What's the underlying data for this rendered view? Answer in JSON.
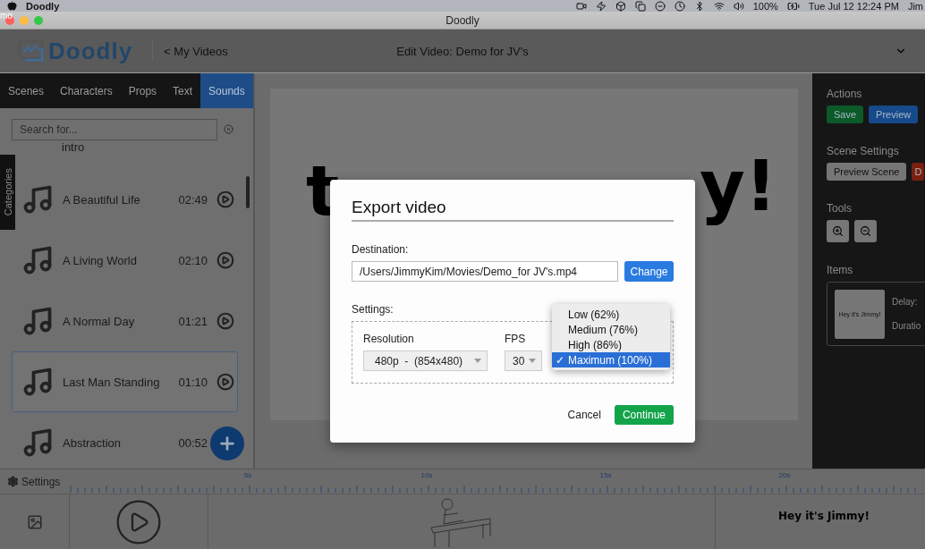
{
  "menubar": {
    "app": "Doodly",
    "battery": "100%",
    "clock": "Tue Jul 12  12:24 PM",
    "user": "Jim"
  },
  "edge_text": "mo",
  "window": {
    "title": "Doodly"
  },
  "header": {
    "logo": "Doodly",
    "back_link": "< My Videos",
    "title": "Edit Video: Demo for JV's"
  },
  "tabs": [
    {
      "label": "Scenes",
      "selected": false
    },
    {
      "label": "Characters",
      "selected": false
    },
    {
      "label": "Props",
      "selected": false
    },
    {
      "label": "Text",
      "selected": false
    },
    {
      "label": "Sounds",
      "selected": true
    }
  ],
  "search": {
    "placeholder": "Search for..."
  },
  "categories_tab": "Categories",
  "sounds": [
    {
      "name": "intro",
      "kind": "partial",
      "selected": false
    },
    {
      "name": "A Beautiful Life",
      "duration": "02:49",
      "selected": false
    },
    {
      "name": "A Living World",
      "duration": "02:10",
      "selected": false
    },
    {
      "name": "A Normal Day",
      "duration": "01:21",
      "selected": false
    },
    {
      "name": "Last Man Standing",
      "duration": "01:10",
      "selected": true
    },
    {
      "name": "Abstraction",
      "duration": "00:52",
      "kind": "covered",
      "selected": false
    }
  ],
  "canvas": {
    "fragments": [
      "t",
      "y!"
    ]
  },
  "actions": {
    "heading": "Actions",
    "buttons": [
      {
        "label": "Save",
        "kind": "save"
      },
      {
        "label": "Preview",
        "kind": "preview"
      }
    ]
  },
  "scene_settings": {
    "heading": "Scene Settings",
    "buttons": [
      {
        "label": "Preview Scene",
        "kind": "neutral"
      },
      {
        "label": "D",
        "kind": "danger"
      }
    ]
  },
  "tools": {
    "heading": "Tools"
  },
  "items": {
    "heading": "Items",
    "thumbnail_text": "Hey it's Jimmy!",
    "fields": [
      "Delay:",
      "Duratio"
    ]
  },
  "timeline": {
    "settings_label": "Settings",
    "ticks": [
      "5s",
      "10s",
      "15s",
      "20s"
    ],
    "caption": "Hey it's Jimmy!"
  },
  "dialog": {
    "title": "Export video",
    "destination_label": "Destination:",
    "destination": "/Users/JimmyKim/Movies/Demo_for JV's.mp4",
    "change": "Change",
    "settings_label": "Settings:",
    "resolution_label": "Resolution",
    "resolution": "480p  -  (854x480)",
    "fps_label": "FPS",
    "fps": "30",
    "check_mark": "✓",
    "quality_options": [
      {
        "label": "Low (62%)",
        "selected": false
      },
      {
        "label": "Medium (76%)",
        "selected": false
      },
      {
        "label": "High (86%)",
        "selected": false
      },
      {
        "label": "Maximum (100%)",
        "selected": true
      }
    ],
    "cancel": "Cancel",
    "continue": "Continue"
  }
}
